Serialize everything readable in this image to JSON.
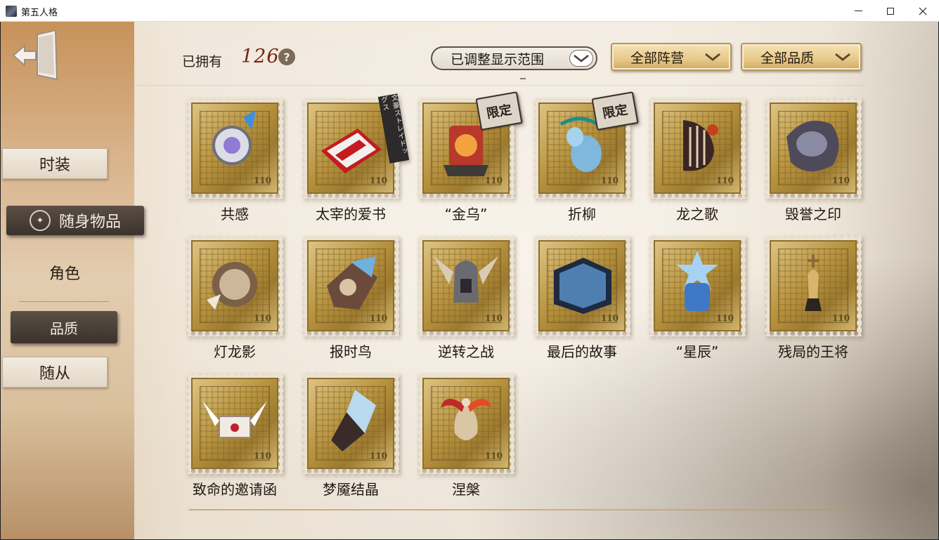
{
  "window": {
    "title": "第五人格",
    "icons": {
      "app": "game-app-icon",
      "minimize": "minimize-icon",
      "maximize": "maximize-icon",
      "close": "close-icon"
    }
  },
  "sidebar": {
    "exit_icon": "exit-door-icon",
    "tabs": [
      {
        "label": "时装",
        "style": "paper"
      },
      {
        "label": "随身物品",
        "style": "dark-selected",
        "icon": "shield-emblem-icon"
      },
      {
        "label": "角色",
        "style": "plain"
      },
      {
        "label": "品质",
        "style": "dark-sub"
      },
      {
        "label": "随从",
        "style": "paper"
      }
    ]
  },
  "header": {
    "owned_label": "已拥有",
    "owned_count": "126",
    "help_icon": "question-icon",
    "filters": {
      "range": "已调整显示范围",
      "camp": "全部阵营",
      "quality": "全部品质"
    }
  },
  "items": [
    {
      "name": "共感",
      "badge": "",
      "art": "gear-crystal"
    },
    {
      "name": "太宰的爱书",
      "badge": "文豪ストレイドッグス",
      "art": "red-book"
    },
    {
      "name": "“金乌”",
      "badge": "限定",
      "art": "bird-scroll"
    },
    {
      "name": "折柳",
      "badge": "限定",
      "art": "willow-gourd"
    },
    {
      "name": "龙之歌",
      "badge": "",
      "art": "dragon-harp"
    },
    {
      "name": "毁誉之印",
      "badge": "",
      "art": "dark-seal"
    },
    {
      "name": "灯龙影",
      "badge": "",
      "art": "dragon-lantern"
    },
    {
      "name": "报时鸟",
      "badge": "",
      "art": "clock-bird"
    },
    {
      "name": "逆转之战",
      "badge": "",
      "art": "winged-helmet"
    },
    {
      "name": "最后的故事",
      "badge": "",
      "art": "blue-book"
    },
    {
      "name": "“星辰”",
      "badge": "",
      "art": "star-bottle"
    },
    {
      "name": "残局的王将",
      "badge": "",
      "art": "chess-king"
    },
    {
      "name": "致命的邀请函",
      "badge": "",
      "art": "winged-letter"
    },
    {
      "name": "梦魇结晶",
      "badge": "",
      "art": "nightmare-crystal"
    },
    {
      "name": "涅槃",
      "badge": "",
      "art": "phoenix"
    }
  ],
  "stamp_value": "110",
  "colors": {
    "accent_count": "#7a2318",
    "gold": "#c9a45c",
    "dark_tab": "#3b332c"
  }
}
